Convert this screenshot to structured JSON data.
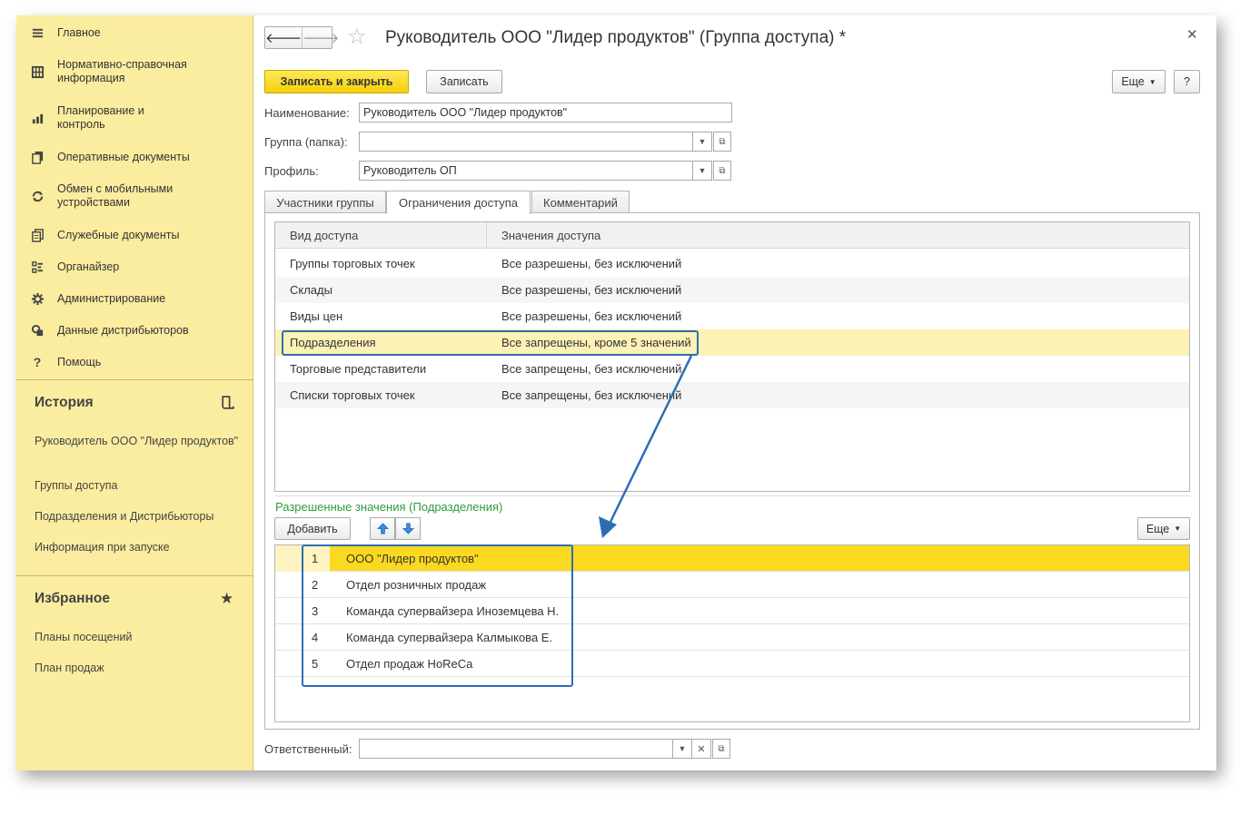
{
  "sidebar": {
    "nav_items": [
      {
        "label": "Главное",
        "icon": "menu-icon"
      },
      {
        "label": "Нормативно-справочная информация",
        "icon": "grid-icon"
      },
      {
        "label": "Планирование и контроль",
        "icon": "bar-chart-icon"
      },
      {
        "label": "Оперативные документы",
        "icon": "documents-icon"
      },
      {
        "label": "Обмен с мобильными устройствами",
        "icon": "sync-icon"
      },
      {
        "label": "Служебные документы",
        "icon": "service-docs-icon"
      },
      {
        "label": "Органайзер",
        "icon": "organizer-icon"
      },
      {
        "label": "Администрирование",
        "icon": "gear-icon"
      },
      {
        "label": "Данные дистрибьюторов",
        "icon": "distributor-icon"
      },
      {
        "label": "Помощь",
        "icon": "help-icon"
      }
    ],
    "history": {
      "title": "История",
      "items": [
        "Руководитель ООО \"Лидер продуктов\"",
        "Группы доступа",
        "Подразделения и Дистрибьюторы",
        "Информация при запуске"
      ]
    },
    "favorites": {
      "title": "Избранное",
      "items": [
        "Планы посещений",
        "План продаж"
      ]
    }
  },
  "header": {
    "title": "Руководитель ООО \"Лидер продуктов\" (Группа доступа) *"
  },
  "toolbar": {
    "save_close_label": "Записать и закрыть",
    "save_label": "Записать",
    "more_label": "Еще",
    "help_label": "?"
  },
  "form": {
    "name_label": "Наименование:",
    "name_value": "Руководитель ООО \"Лидер продуктов\"",
    "group_label": "Группа (папка):",
    "group_value": "",
    "profile_label": "Профиль:",
    "profile_value": "Руководитель ОП",
    "responsible_label": "Ответственный:",
    "responsible_value": ""
  },
  "tabs": [
    "Участники группы",
    "Ограничения доступа",
    "Комментарий"
  ],
  "access_table": {
    "columns": [
      "Вид доступа",
      "Значения доступа"
    ],
    "rows": [
      [
        "Группы торговых точек",
        "Все разрешены, без исключений"
      ],
      [
        "Склады",
        "Все разрешены, без исключений"
      ],
      [
        "Виды цен",
        "Все разрешены, без исключений"
      ],
      [
        "Подразделения",
        "Все запрещены, кроме 5 значений"
      ],
      [
        "Торговые представители",
        "Все запрещены, без исключений"
      ],
      [
        "Списки торговых точек",
        "Все запрещены, без исключений"
      ]
    ]
  },
  "allowed": {
    "title": "Разрешенные значения (Подразделения)",
    "add_label": "Добавить",
    "more_label": "Еще",
    "rows": [
      [
        "1",
        "ООО \"Лидер продуктов\""
      ],
      [
        "2",
        "Отдел розничных продаж"
      ],
      [
        "3",
        "Команда супервайзера  Иноземцева Н."
      ],
      [
        "4",
        "Команда супервайзера Калмыкова Е."
      ],
      [
        "5",
        "Отдел продаж HoReCa"
      ]
    ]
  },
  "colors": {
    "sidebar_bg": "#fbeda0",
    "primary_button": "#f6d10a",
    "selected_row": "#fcd921",
    "highlight_box": "#2d6db4",
    "section_title": "#2d9b3c"
  }
}
